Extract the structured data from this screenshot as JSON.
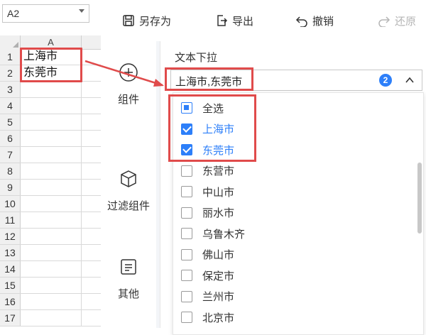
{
  "sheet": {
    "name_box": "A2",
    "column": "A",
    "rows": [
      {
        "n": "1",
        "v": "上海市"
      },
      {
        "n": "2",
        "v": "东莞市"
      },
      {
        "n": "3",
        "v": ""
      },
      {
        "n": "4",
        "v": ""
      },
      {
        "n": "5",
        "v": ""
      },
      {
        "n": "6",
        "v": ""
      },
      {
        "n": "7",
        "v": ""
      },
      {
        "n": "8",
        "v": ""
      },
      {
        "n": "9",
        "v": ""
      },
      {
        "n": "10",
        "v": ""
      },
      {
        "n": "11",
        "v": ""
      },
      {
        "n": "12",
        "v": ""
      },
      {
        "n": "13",
        "v": ""
      },
      {
        "n": "14",
        "v": ""
      },
      {
        "n": "15",
        "v": ""
      },
      {
        "n": "16",
        "v": ""
      },
      {
        "n": "17",
        "v": ""
      }
    ]
  },
  "toolbar": {
    "save_as": "另存为",
    "export": "导出",
    "undo": "撤销",
    "redo": "还原"
  },
  "nav": {
    "components": "组件",
    "filter_components": "过滤组件",
    "other": "其他"
  },
  "filter": {
    "title": "文本下拉",
    "selected_text": "上海市,东莞市",
    "selected_count": "2",
    "options": [
      {
        "label": "全选",
        "state": "partial"
      },
      {
        "label": "上海市",
        "state": "checked"
      },
      {
        "label": "东莞市",
        "state": "checked"
      },
      {
        "label": "东营市",
        "state": "unchecked"
      },
      {
        "label": "中山市",
        "state": "unchecked"
      },
      {
        "label": "丽水市",
        "state": "unchecked"
      },
      {
        "label": "乌鲁木齐",
        "state": "unchecked"
      },
      {
        "label": "佛山市",
        "state": "unchecked"
      },
      {
        "label": "保定市",
        "state": "unchecked"
      },
      {
        "label": "兰州市",
        "state": "unchecked"
      },
      {
        "label": "北京市",
        "state": "unchecked"
      }
    ]
  },
  "colors": {
    "accent": "#2d7ff9",
    "annotation_red": "#e04b4b"
  }
}
